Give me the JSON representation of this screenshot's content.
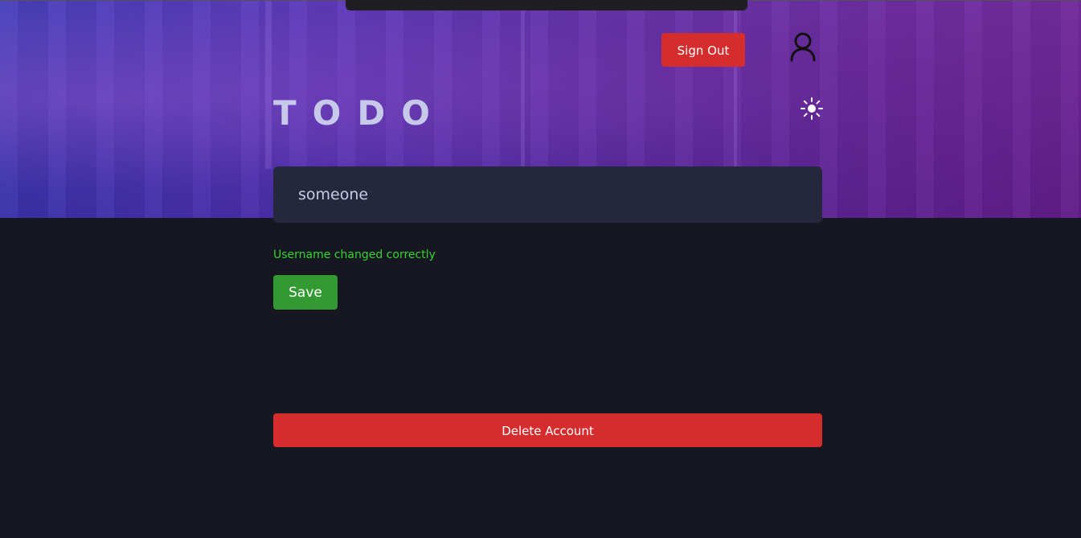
{
  "header": {
    "signout_label": "Sign Out",
    "user_icon": "user-icon",
    "title": "TODO",
    "theme_icon": "sun-icon"
  },
  "profile": {
    "username_value": "someone",
    "status_message": "Username changed correctly",
    "save_label": "Save",
    "delete_label": "Delete Account"
  },
  "colors": {
    "background": "#171721",
    "input_background": "#25273c",
    "danger": "#d52d2d",
    "success": "#339933",
    "success_text": "#33d433"
  }
}
